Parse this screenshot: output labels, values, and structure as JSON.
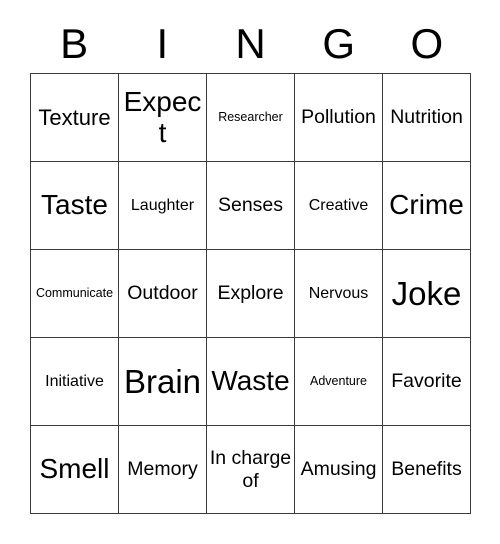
{
  "card": {
    "title_letters": [
      "B",
      "I",
      "N",
      "G",
      "O"
    ],
    "grid_line_color": "#3a3a3a",
    "background_color": "#ffffff",
    "text_color": "#000000",
    "columns": 5,
    "rows": 5,
    "cells": [
      {
        "text": "Texture",
        "size": "sz-l"
      },
      {
        "text": "Expect",
        "size": "sz-xl"
      },
      {
        "text": "Researcher",
        "size": "sz-xs"
      },
      {
        "text": "Pollution",
        "size": "sz-m"
      },
      {
        "text": "Nutrition",
        "size": "sz-m"
      },
      {
        "text": "Taste",
        "size": "sz-xl"
      },
      {
        "text": "Laughter",
        "size": "sz-s"
      },
      {
        "text": "Senses",
        "size": "sz-m"
      },
      {
        "text": "Creative",
        "size": "sz-s"
      },
      {
        "text": "Crime",
        "size": "sz-xl"
      },
      {
        "text": "Communicate",
        "size": "sz-xs"
      },
      {
        "text": "Outdoor",
        "size": "sz-m"
      },
      {
        "text": "Explore",
        "size": "sz-m"
      },
      {
        "text": "Nervous",
        "size": "sz-s"
      },
      {
        "text": "Joke",
        "size": "sz-xxl"
      },
      {
        "text": "Initiative",
        "size": "sz-s"
      },
      {
        "text": "Brain",
        "size": "sz-xxl"
      },
      {
        "text": "Waste",
        "size": "sz-xl"
      },
      {
        "text": "Adventure",
        "size": "sz-xs"
      },
      {
        "text": "Favorite",
        "size": "sz-m"
      },
      {
        "text": "Smell",
        "size": "sz-xl"
      },
      {
        "text": "Memory",
        "size": "sz-m"
      },
      {
        "text": "In charge of",
        "size": "sz-wrap"
      },
      {
        "text": "Amusing",
        "size": "sz-m"
      },
      {
        "text": "Benefits",
        "size": "sz-m"
      }
    ]
  }
}
